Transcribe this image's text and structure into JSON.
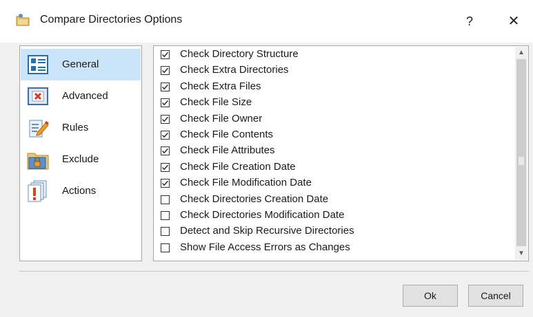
{
  "window": {
    "title": "Compare Directories Options",
    "help_glyph": "?",
    "close_glyph": "✕",
    "icon": "folder-compare-icon"
  },
  "sidebar": {
    "items": [
      {
        "label": "General",
        "icon": "general-list-icon",
        "selected": true
      },
      {
        "label": "Advanced",
        "icon": "advanced-panel-icon",
        "selected": false
      },
      {
        "label": "Rules",
        "icon": "rules-pencil-icon",
        "selected": false
      },
      {
        "label": "Exclude",
        "icon": "exclude-lock-folder-icon",
        "selected": false
      },
      {
        "label": "Actions",
        "icon": "actions-warning-icon",
        "selected": false
      }
    ]
  },
  "options": [
    {
      "label": "Check Directory Structure",
      "checked": true
    },
    {
      "label": "Check Extra Directories",
      "checked": true
    },
    {
      "label": "Check Extra Files",
      "checked": true
    },
    {
      "label": "Check File Size",
      "checked": true
    },
    {
      "label": "Check File Owner",
      "checked": true
    },
    {
      "label": "Check File Contents",
      "checked": true
    },
    {
      "label": "Check File Attributes",
      "checked": true
    },
    {
      "label": "Check File Creation Date",
      "checked": true
    },
    {
      "label": "Check File Modification Date",
      "checked": true
    },
    {
      "label": "Check Directories Creation Date",
      "checked": false
    },
    {
      "label": "Check Directories Modification Date",
      "checked": false
    },
    {
      "label": "Detect and Skip Recursive Directories",
      "checked": false
    },
    {
      "label": "Show File Access Errors as Changes",
      "checked": false
    }
  ],
  "buttons": {
    "ok": "Ok",
    "cancel": "Cancel"
  },
  "colors": {
    "selection": "#cce4f7",
    "accent": "#1e6fb8"
  }
}
